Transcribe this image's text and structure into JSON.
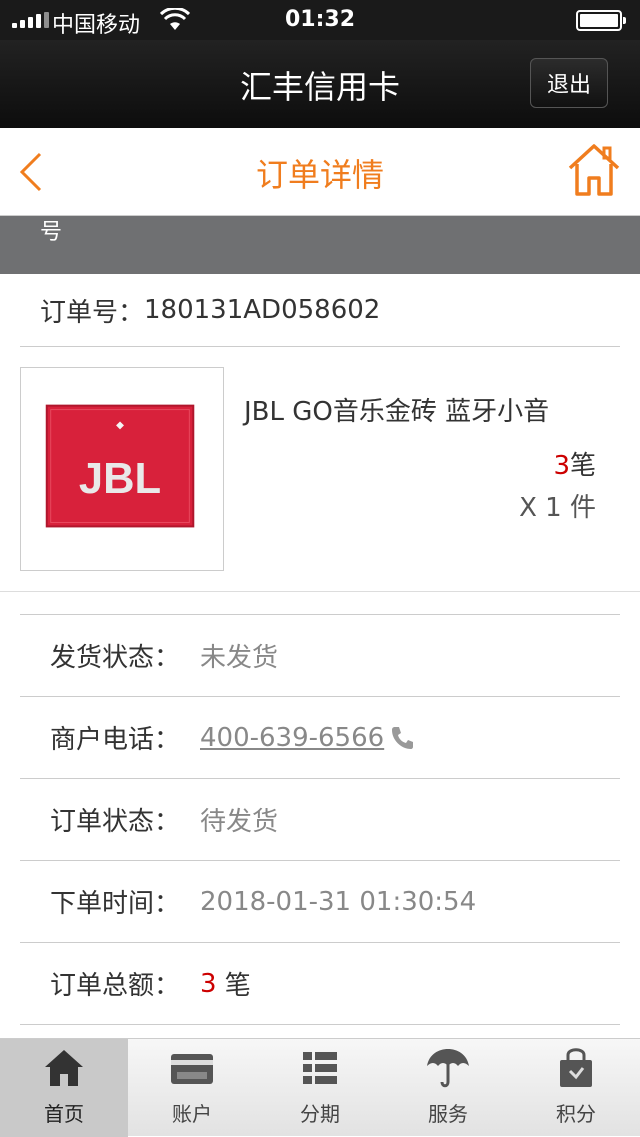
{
  "status_bar": {
    "carrier": "中国移动",
    "time": "01:32",
    "icons": [
      "signal-icon",
      "wifi-icon",
      "battery-icon"
    ]
  },
  "app_bar": {
    "title": "汇丰信用卡",
    "logout_label": "退出"
  },
  "nav_bar": {
    "title": "订单详情",
    "back_icon": "back-chevron-icon",
    "home_icon": "home-icon"
  },
  "gray_band": {
    "text": "号"
  },
  "order": {
    "number_label": "订单号：",
    "number_value": "180131AD058602"
  },
  "product": {
    "name": "JBL GO音乐金砖 蓝牙小音",
    "price_value": "3",
    "price_unit": "笔",
    "quantity": "X 1 件",
    "image_logo_text": "JBL",
    "image_color": "#d8213b"
  },
  "details": [
    {
      "label": "发货状态：",
      "value": "未发货"
    },
    {
      "label": "商户电话：",
      "value": "400-639-6566 "
    },
    {
      "label": "订单状态：",
      "value": "待发货"
    },
    {
      "label": "下单时间：",
      "value": "2018-01-31 01:30:54"
    },
    {
      "label": "订单总额：",
      "value_num": "3",
      "value_unit": " 笔"
    }
  ],
  "tab_bar": {
    "tabs": [
      {
        "label": "首页",
        "icon": "home-icon",
        "active": true
      },
      {
        "label": "账户",
        "icon": "card-icon"
      },
      {
        "label": "分期",
        "icon": "list-icon"
      },
      {
        "label": "服务",
        "icon": "umbrella-icon"
      },
      {
        "label": "积分",
        "icon": "shopping-bag-icon"
      }
    ]
  },
  "colors": {
    "accent_orange": "#f07d1e",
    "price_red": "#cc0000",
    "header_dark": "#111111",
    "gray_band": "#6f7072"
  }
}
